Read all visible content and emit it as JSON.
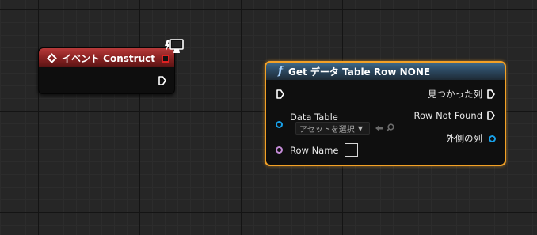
{
  "event_node": {
    "title": "イベント Construct"
  },
  "function_node": {
    "title": "Get データ Table Row NONE",
    "inputs": {
      "data_table_label": "Data Table",
      "data_table_value": "アセットを選択",
      "row_name_label": "Row Name"
    },
    "outputs": {
      "found_label": "見つかった列",
      "not_found_label": "Row Not Found",
      "out_row_label": "外側の列"
    }
  },
  "colors": {
    "event_header": "#8e2424",
    "function_header": "#2e4c66",
    "selection_outline": "#f3a126",
    "struct_pin": "#18a0e8",
    "name_pin": "#c58cd8",
    "delegate_pin": "#dd2222"
  },
  "icons": [
    "event-diamond-icon",
    "exec-pin-icon",
    "monitor-icon",
    "function-icon",
    "struct-pin-icon",
    "name-pin-icon",
    "back-arrow-icon",
    "search-icon"
  ]
}
